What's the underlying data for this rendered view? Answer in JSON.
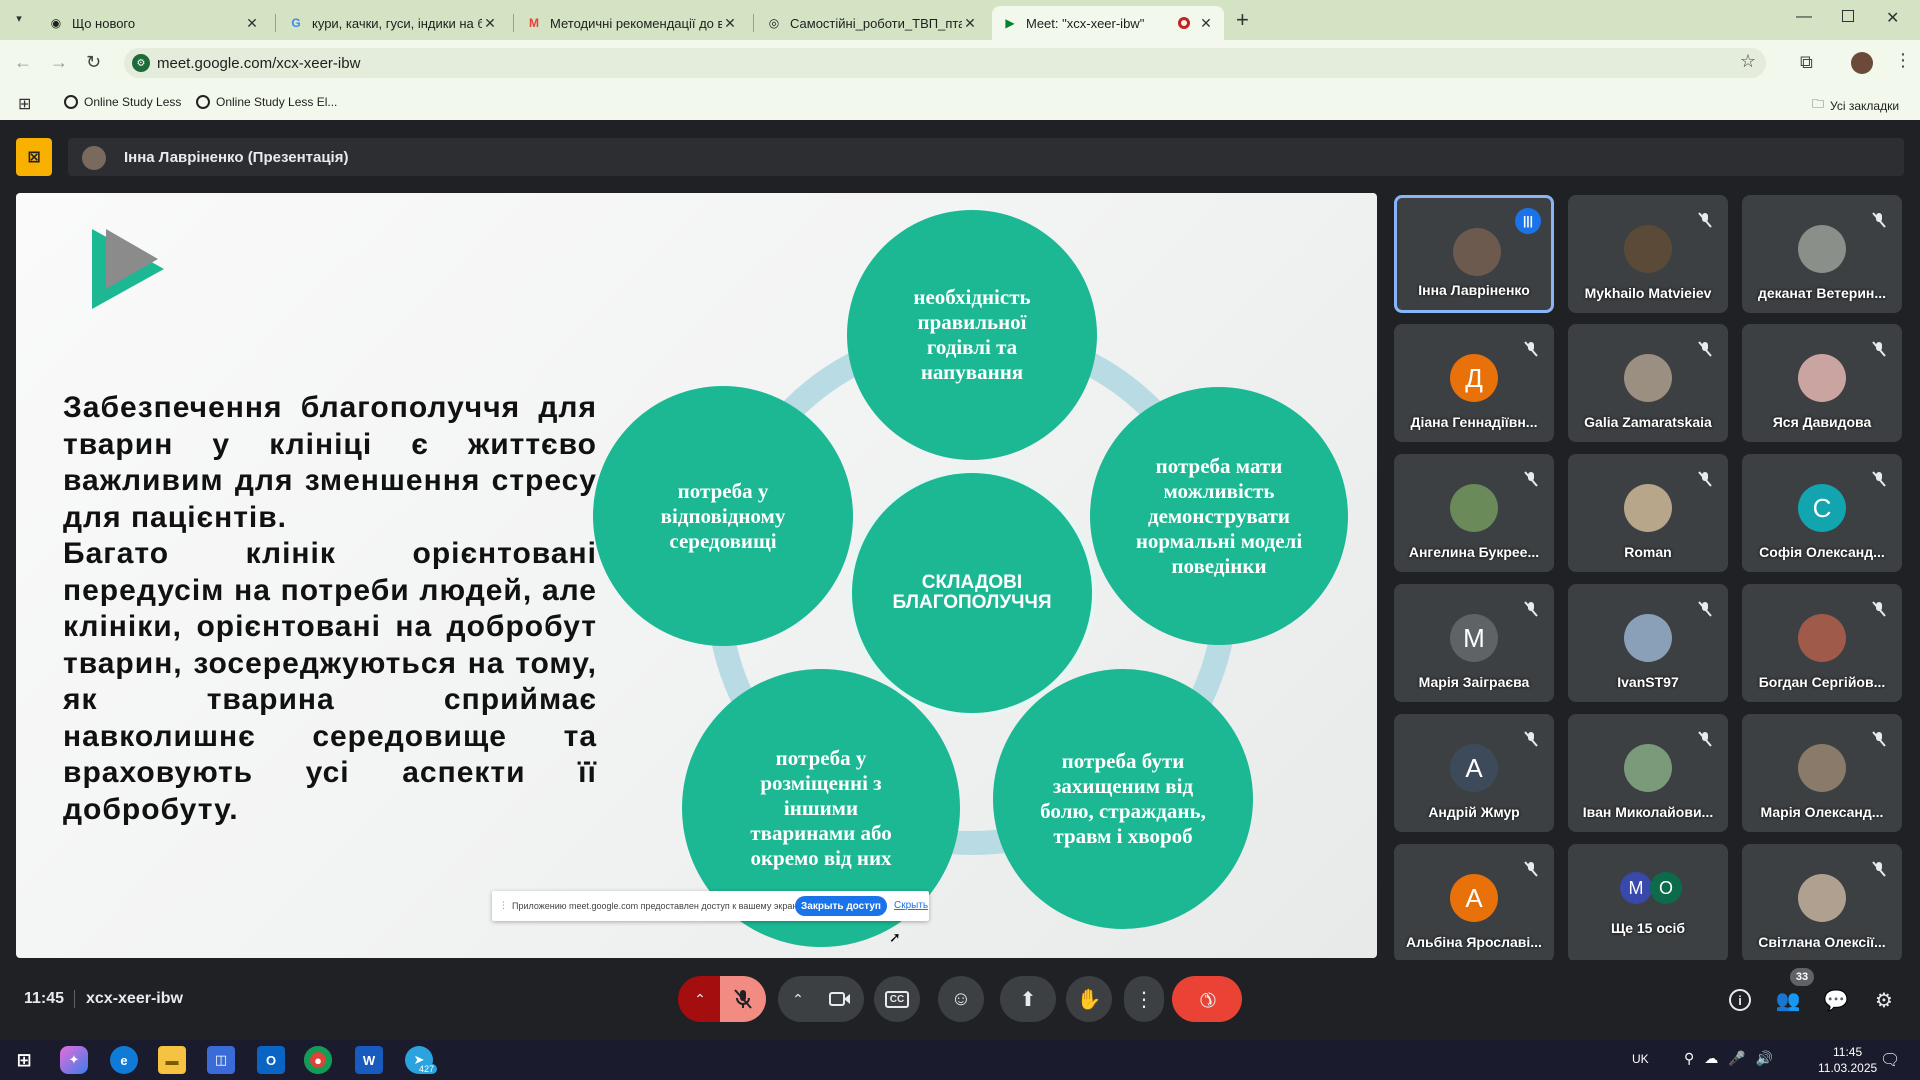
{
  "browser": {
    "tabs": [
      {
        "title": "Що нового",
        "icon": "circle-icon"
      },
      {
        "title": "кури, качки, гуси, індики на бі",
        "icon": "google-icon"
      },
      {
        "title": "Методичні рекомендації до ві",
        "icon": "gmail-icon"
      },
      {
        "title": "Самостійні_роботи_ТВП_птахів",
        "icon": "globe-icon"
      },
      {
        "title": "Meet: \"xcx-xeer-ibw\"",
        "icon": "meet-icon"
      }
    ],
    "new_tab": "+",
    "url": "meet.google.com/xcx-xeer-ibw",
    "bookmarks": [
      "Online Study Less",
      "Online Study Less El..."
    ],
    "all_bookmarks": "Усі закладки"
  },
  "meet": {
    "presenter_label": "Інна Лавріненко (Презентація)",
    "clock": "11:45",
    "meeting_code": "xcx-xeer-ibw",
    "people_count": "33",
    "share_banner": {
      "text": "Приложению meet.google.com предоставлен доступ к вашему экрану.",
      "stop": "Закрыть доступ",
      "hide": "Скрыть"
    }
  },
  "slide": {
    "paragraph": "Забезпечення благополуччя для тварин у клініці є життєво важливим для зменшення стресу для пацієнтів.\nБагато клінік орієнтовані передусім на потреби людей, але клініки, орієнтовані на добробут тварин, зосереджуються на тому, як тварина сприймає навколишнє середовище та враховують усі аспекти її добробуту.",
    "center": "СКЛАДОВІ БЛАГОПОЛУЧЧЯ",
    "needs": [
      "необхідність правильної годівлі та напування",
      "потреба мати можливість демонструвати нормальні моделі поведінки",
      "потреба бути захищеним від болю, страждань, травм і хвороб",
      "потреба у розміщенні з іншими тваринами або окремо від них",
      "потреба у відповідному середовищі"
    ]
  },
  "participants": [
    {
      "name": "Інна Лавріненко",
      "initial": "",
      "color": "#6d5a4e"
    },
    {
      "name": "Mykhailo Matvieiev",
      "initial": "",
      "color": "#5b4a38"
    },
    {
      "name": "деканат Ветерин...",
      "initial": "",
      "color": "#8a8f8a"
    },
    {
      "name": "Діана Геннадіївн...",
      "initial": "Д",
      "color": "#e8710a"
    },
    {
      "name": "Galia Zamaratskaia",
      "initial": "",
      "color": "#9a8f80"
    },
    {
      "name": "Яся Давидова",
      "initial": "",
      "color": "#c9a4a0"
    },
    {
      "name": "Ангелина Букрее...",
      "initial": "",
      "color": "#6b8a5a"
    },
    {
      "name": "Roman",
      "initial": "",
      "color": "#b8a68a"
    },
    {
      "name": "Софія Олександ...",
      "initial": "С",
      "color": "#12a4af"
    },
    {
      "name": "Марія Заіграєва",
      "initial": "М",
      "color": "#5f6368"
    },
    {
      "name": "IvanST97",
      "initial": "",
      "color": "#8aa0b8"
    },
    {
      "name": "Богдан Сергійов...",
      "initial": "",
      "color": "#a05a4a"
    },
    {
      "name": "Андрій Жмур",
      "initial": "А",
      "color": "#3c4a5a"
    },
    {
      "name": "Іван Миколайови...",
      "initial": "",
      "color": "#7a9a7a"
    },
    {
      "name": "Марія Олександ...",
      "initial": "",
      "color": "#8a7a6a"
    },
    {
      "name": "Альбіна Ярославі...",
      "initial": "А",
      "color": "#e8710a"
    },
    {
      "name": "Ще 15 осіб",
      "initial": "",
      "color": ""
    },
    {
      "name": "Світлана Олексії...",
      "initial": "",
      "color": "#b0a090"
    }
  ],
  "more_people": {
    "a": "М",
    "b": "О"
  },
  "taskbar": {
    "lang": "UK",
    "time": "11:45",
    "date": "11.03.2025",
    "telegram_badge": "427"
  },
  "colors": {
    "accent": "#1cb894",
    "meet_bg": "#202124",
    "end_call": "#ea4335",
    "present": "#f9b100"
  }
}
